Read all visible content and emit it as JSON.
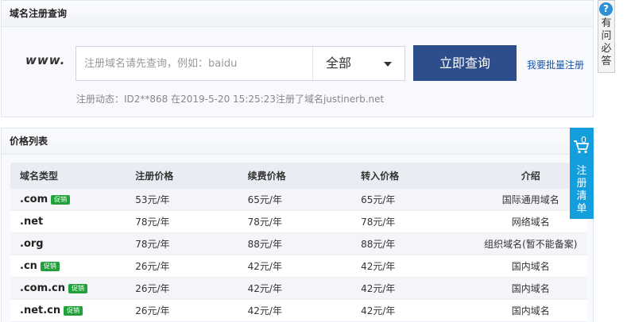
{
  "search_panel": {
    "title": "域名注册查询",
    "www": "www.",
    "placeholder": "注册域名请先查询，例如：baidu",
    "select_value": "全部",
    "query_button": "立即查询",
    "bulk_link": "我要批量注册",
    "registration_news": "注册动态：ID2**868 在2019-5-20 15:25:23注册了域名justinerb.net"
  },
  "price_panel": {
    "title": "价格列表",
    "headers": [
      "域名类型",
      "注册价格",
      "续费价格",
      "转入价格",
      "介绍"
    ],
    "promo_badge": "促销",
    "rows": [
      {
        "domain": ".com",
        "promo": true,
        "reg": "53元/年",
        "renew": "65元/年",
        "transfer": "65元/年",
        "intro": "国际通用域名"
      },
      {
        "domain": ".net",
        "promo": false,
        "reg": "78元/年",
        "renew": "78元/年",
        "transfer": "78元/年",
        "intro": "网络域名"
      },
      {
        "domain": ".org",
        "promo": false,
        "reg": "78元/年",
        "renew": "88元/年",
        "transfer": "88元/年",
        "intro": "组织域名(暂不能备案)"
      },
      {
        "domain": ".cn",
        "promo": true,
        "reg": "26元/年",
        "renew": "42元/年",
        "transfer": "42元/年",
        "intro": "国内域名"
      },
      {
        "domain": ".com.cn",
        "promo": true,
        "reg": "26元/年",
        "renew": "42元/年",
        "transfer": "42元/年",
        "intro": "国内域名"
      },
      {
        "domain": ".net.cn",
        "promo": true,
        "reg": "26元/年",
        "renew": "42元/年",
        "transfer": "42元/年",
        "intro": "国内域名"
      }
    ]
  },
  "help_widget": {
    "icon": "question-icon",
    "text": "有问必答"
  },
  "cart_widget": {
    "icon": "cart-icon",
    "count": "0",
    "text": "注册清单"
  },
  "colors": {
    "primary_button": "#2d4d8c",
    "cart": "#149ede",
    "promo": "#23a03b",
    "price_red": "#c0281f",
    "link": "#1a56a8"
  }
}
